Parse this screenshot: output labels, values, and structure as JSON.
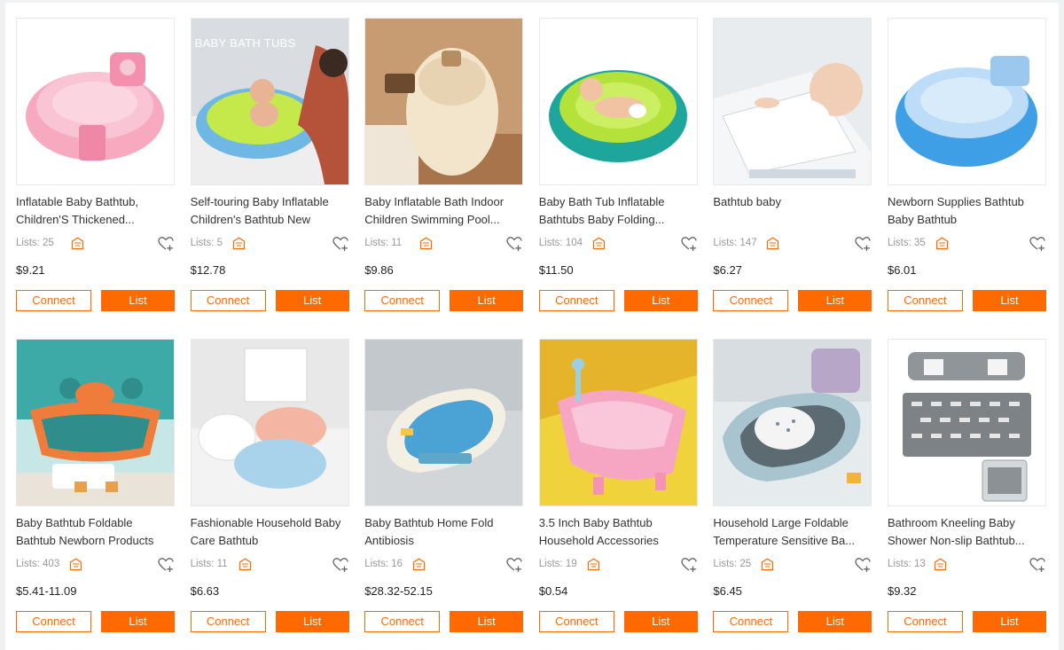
{
  "colors": {
    "accent": "#ff6a00",
    "store_icon": "#ff6a00"
  },
  "buttons": {
    "connect_label": "Connect",
    "list_label": "List"
  },
  "icons": {
    "store": "store-icon",
    "favorite": "heart-plus-icon"
  },
  "products": [
    {
      "title": "Inflatable Baby Bathtub, Children'S Thickened...",
      "lists": "Lists: 25",
      "price": "$9.21"
    },
    {
      "title": "Self-touring Baby Inflatable Children's Bathtub New",
      "lists": "Lists: 5",
      "price": "$12.78",
      "image_text": "BABY BATH TUBS"
    },
    {
      "title": "Baby Inflatable Bath Indoor Children Swimming Pool...",
      "lists": "Lists: 11",
      "price": "$9.86"
    },
    {
      "title": "Baby Bath Tub Inflatable Bathtubs Baby Folding...",
      "lists": "Lists: 104",
      "price": "$11.50"
    },
    {
      "title": "Bathtub baby",
      "lists": "Lists: 147",
      "price": "$6.27"
    },
    {
      "title": "Newborn Supplies Bathtub Baby Bathtub",
      "lists": "Lists: 35",
      "price": "$6.01"
    },
    {
      "title": "Baby Bathtub Foldable Bathtub Newborn Products",
      "lists": "Lists: 403",
      "price": "$5.41-11.09"
    },
    {
      "title": "Fashionable Household Baby Care Bathtub",
      "lists": "Lists: 11",
      "price": "$6.63"
    },
    {
      "title": "Baby Bathtub Home Fold Antibiosis",
      "lists": "Lists: 16",
      "price": "$28.32-52.15"
    },
    {
      "title": "3.5 Inch Baby Bathtub Household Accessories",
      "lists": "Lists: 19",
      "price": "$0.54"
    },
    {
      "title": "Household Large Foldable Temperature Sensitive Ba...",
      "lists": "Lists: 25",
      "price": "$6.45"
    },
    {
      "title": "Bathroom Kneeling Baby Shower Non-slip Bathtub...",
      "lists": "Lists: 13",
      "price": "$9.32"
    }
  ]
}
